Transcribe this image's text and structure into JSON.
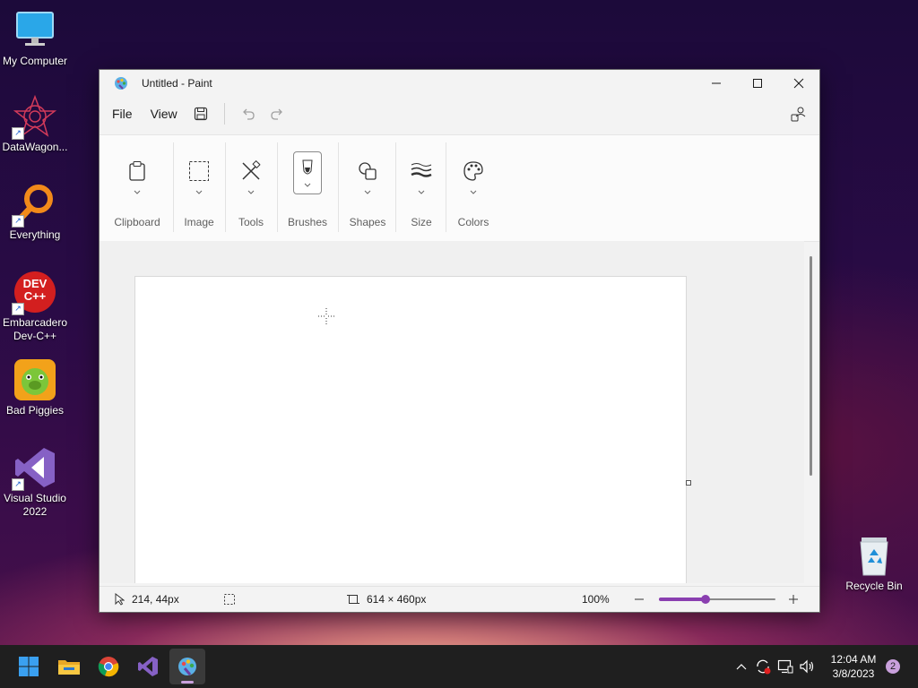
{
  "desktop": {
    "icons": [
      {
        "label": "My Computer"
      },
      {
        "label": "DataWagon..."
      },
      {
        "label": "Everything"
      },
      {
        "label": "Embarcadero Dev-C++"
      },
      {
        "label": "Bad Piggies"
      },
      {
        "label": "Visual Studio 2022"
      },
      {
        "label": "Recycle Bin"
      }
    ],
    "devcpp_badge": "DEV C++"
  },
  "window": {
    "title": "Untitled - Paint",
    "menu": {
      "file": "File",
      "view": "View"
    },
    "ribbon": {
      "groups": [
        {
          "label": "Clipboard",
          "icon": "clipboard-icon"
        },
        {
          "label": "Image",
          "icon": "selection-icon"
        },
        {
          "label": "Tools",
          "icon": "tools-icon"
        },
        {
          "label": "Brushes",
          "icon": "brush-icon",
          "selected": true
        },
        {
          "label": "Shapes",
          "icon": "shapes-icon"
        },
        {
          "label": "Size",
          "icon": "size-icon"
        },
        {
          "label": "Colors",
          "icon": "palette-icon"
        }
      ]
    },
    "status": {
      "cursor_pos": "214, 44px",
      "canvas_size": "614 × 460px",
      "zoom": "100%",
      "zoom_level": 0.4
    }
  },
  "taskbar": {
    "apps": [
      "start",
      "file-explorer",
      "chrome",
      "visual-studio",
      "paint"
    ],
    "active": "paint",
    "time": "12:04 AM",
    "date": "3/8/2023",
    "notifications": "2"
  },
  "colors": {
    "accent": "#8a3fb0",
    "taskbar": "#1f1f1f",
    "window_bg": "#f3f3f3"
  }
}
